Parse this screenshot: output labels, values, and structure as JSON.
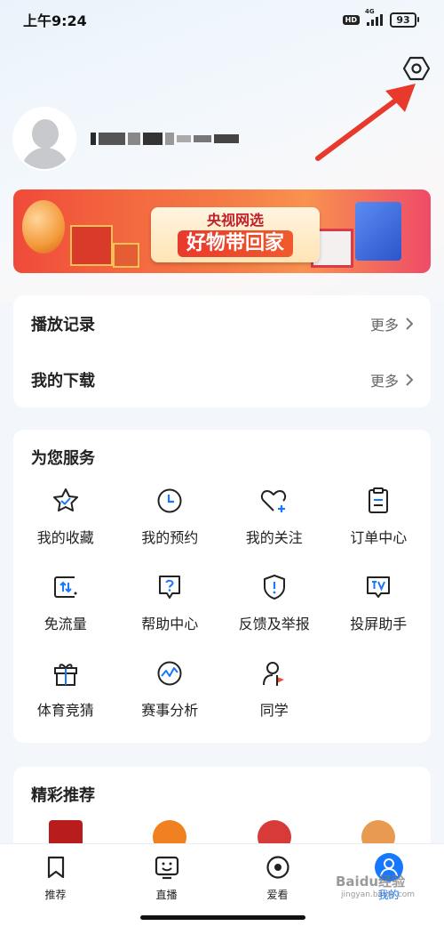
{
  "status_bar": {
    "time": "上午9:24",
    "network": "4G",
    "hd": "HD",
    "battery": "93"
  },
  "banner": {
    "brand": "央视网选",
    "slogan": "好物带回家"
  },
  "records": [
    {
      "title": "播放记录",
      "more": "更多"
    },
    {
      "title": "我的下载",
      "more": "更多"
    }
  ],
  "services": {
    "title": "为您服务",
    "items": [
      {
        "label": "我的收藏",
        "icon": "star-icon"
      },
      {
        "label": "我的预约",
        "icon": "clock-icon"
      },
      {
        "label": "我的关注",
        "icon": "heart-plus-icon"
      },
      {
        "label": "订单中心",
        "icon": "clipboard-icon"
      },
      {
        "label": "免流量",
        "icon": "data-arrows-icon"
      },
      {
        "label": "帮助中心",
        "icon": "help-bubble-icon"
      },
      {
        "label": "反馈及举报",
        "icon": "shield-alert-icon"
      },
      {
        "label": "投屏助手",
        "icon": "tv-cast-icon"
      },
      {
        "label": "体育竞猜",
        "icon": "gift-icon"
      },
      {
        "label": "赛事分析",
        "icon": "analysis-icon"
      },
      {
        "label": "同学",
        "icon": "classmate-icon"
      }
    ]
  },
  "recommend": {
    "title": "精彩推荐"
  },
  "tabbar": {
    "tabs": [
      {
        "label": "推荐",
        "icon": "bookmark-icon"
      },
      {
        "label": "直播",
        "icon": "tv-face-icon"
      },
      {
        "label": "爱看",
        "icon": "target-icon"
      },
      {
        "label": "我的",
        "icon": "user-icon"
      }
    ],
    "active": 3
  },
  "watermark": {
    "text": "Baidu经验",
    "sub": "jingyan.baidu.com"
  },
  "colors": {
    "accent": "#1677ff",
    "arrow": "#e8392d",
    "banner_red": "#f04a3a"
  }
}
